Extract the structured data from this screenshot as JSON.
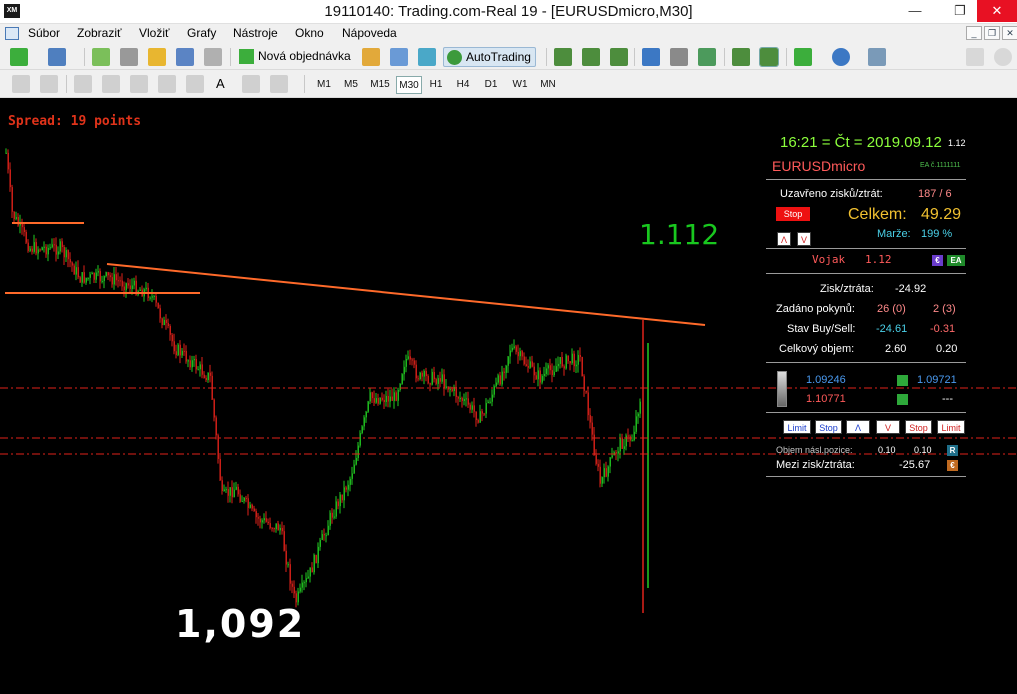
{
  "window": {
    "title": "19110140: Trading.com-Real 19 - [EURUSDmicro,M30]",
    "logo": "XM",
    "minimize_icon": "—",
    "restore_icon": "❐",
    "close_icon": "✕"
  },
  "menu": {
    "items": [
      "Súbor",
      "Zobraziť",
      "Vložiť",
      "Grafy",
      "Nástroje",
      "Okno",
      "Nápoveda"
    ]
  },
  "toolbar1": {
    "new_order": "Nová objednávka",
    "auto_trading": "AutoTrading"
  },
  "toolbar2": {
    "timeframes": [
      "M1",
      "M5",
      "M15",
      "M30",
      "H1",
      "H4",
      "D1",
      "W1",
      "MN"
    ],
    "active_timeframe": "M30",
    "text_tool": "A"
  },
  "chart": {
    "spread": "Spread: 19 points",
    "annotation_high": "1.112",
    "annotation_low": "1,092",
    "colors": {
      "bull": "#22cc22",
      "bear": "#e0221a",
      "trendline": "#ff6a2a",
      "hline": "#e0221a",
      "annotation_high": "#19c71f",
      "annotation_low": "#ffffff"
    }
  },
  "panel": {
    "clock": "16:21 = Čt = 2019.09.12",
    "clock_version": "1.12",
    "symbol": "EURUSDmicro",
    "ea_number": "EA č.1111111",
    "closed_label": "Uzavřeno zisků/ztrát:",
    "closed_value": "187 / 6",
    "stop_button": "Stop",
    "total_label": "Celkem:",
    "total_value": "49.29",
    "up_button": "Λ",
    "down_button": "V",
    "margin_label": "Marže:",
    "margin_value": "199 %",
    "vojak": "Vojak",
    "vojak_version": "1.12",
    "euro_badge": "€",
    "ea_badge": "EA",
    "pl_label": "Zisk/ztráta:",
    "pl_value": "-24.92",
    "orders_label": "Zadáno pokynů:",
    "orders_buy": "26 (0)",
    "orders_sell": "2 (3)",
    "state_label": "Stav Buy/Sell:",
    "state_buy": "-24.61",
    "state_sell": "-0.31",
    "volume_label": "Celkový objem:",
    "volume_buy": "2.60",
    "volume_sell": "0.20",
    "price_buy": "1.09246",
    "price_buy_2": "1.09721",
    "price_sell": "1.10771",
    "price_sell_2": "---",
    "buttons": [
      "Limit",
      "Stop",
      "Λ",
      "V",
      "Stop",
      "Limit"
    ],
    "next_volume_label": "Objem násl.pozice:",
    "next_volume_buy": "0.10",
    "next_volume_sell": "0.10",
    "r_badge": "R",
    "between_label": "Mezi zisk/ztráta:",
    "between_value": "-25.67"
  }
}
